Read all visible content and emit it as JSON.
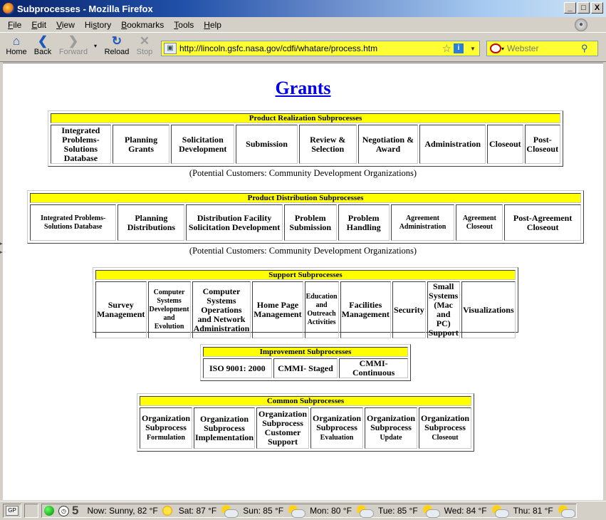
{
  "window": {
    "title": "Subprocesses - Mozilla Firefox",
    "min": "_",
    "max": "□",
    "close": "X"
  },
  "menu": [
    "File",
    "Edit",
    "View",
    "History",
    "Bookmarks",
    "Tools",
    "Help"
  ],
  "menu_underline": [
    "F",
    "E",
    "V",
    "s",
    "B",
    "T",
    "H"
  ],
  "toolbar": {
    "home": "Home",
    "back": "Back",
    "forward": "Forward",
    "reload": "Reload",
    "stop": "Stop",
    "url": "http://lincoln.gsfc.nasa.gov/cdfi/whatare/process.htm",
    "search_placeholder": "Webster"
  },
  "page": {
    "title": "Grants",
    "groups": [
      {
        "header": "Product Realization Subprocesses",
        "cells": [
          "Integrated Problems-Solutions Database",
          "Planning Grants",
          "Solicitation Development",
          "Submission",
          "Review & Selection",
          "Negotiation & Award",
          "Administration",
          "Closeout",
          "Post-Closeout"
        ],
        "caption": "(Potential Customers: Community Development Organizations)"
      },
      {
        "header": "Product Distribution Subprocesses",
        "cells": [
          "Integrated Problems-Solutions Database",
          "Planning Distributions",
          "Distribution Facility Solicitation Development",
          "Problem Submission",
          "Problem Handling",
          "Agreement Administration",
          "Agreement Closeout",
          "Post-Agreement Closeout"
        ],
        "caption": "(Potential Customers: Community Development Organizations)"
      },
      {
        "header": "Support Subprocesses",
        "cells": [
          "Survey Management",
          "Computer Systems Development and Evolution",
          "Computer Systems Operations and Network Administration",
          "Home Page Management",
          "Education and Outreach Activities",
          "Facilities Management",
          "Security",
          "Small Systems (Mac and PC) Support",
          "Visualizations"
        ]
      },
      {
        "header": "Improvement Subprocesses",
        "cells": [
          "ISO 9001: 2000",
          "CMMI- Staged",
          "CMMI- Continuous"
        ]
      },
      {
        "header": "Common Subprocesses",
        "cells": [
          {
            "main": "Organization Subprocess",
            "sub": "Formulation"
          },
          {
            "main": "Organization Subprocess",
            "sub": "Implementation"
          },
          {
            "main": "Organization Subprocess",
            "sub": "Customer Support"
          },
          {
            "main": "Organization Subprocess",
            "sub": "Evaluation"
          },
          {
            "main": "Organization Subprocess",
            "sub": "Update"
          },
          {
            "main": "Organization Subprocess",
            "sub": "Closeout"
          }
        ]
      }
    ]
  },
  "status": {
    "gp": "GP",
    "count": "5",
    "weather": [
      {
        "label": "Now: Sunny, 82 °F",
        "icon": "sun-icon"
      },
      {
        "label": "Sat: 87 °F",
        "icon": "partly-cloudy-icon"
      },
      {
        "label": "Sun: 85 °F",
        "icon": "partly-cloudy-icon"
      },
      {
        "label": "Mon: 80 °F",
        "icon": "partly-cloudy-icon"
      },
      {
        "label": "Tue: 85 °F",
        "icon": "partly-cloudy-icon"
      },
      {
        "label": "Wed: 84 °F",
        "icon": "partly-cloudy-icon"
      },
      {
        "label": "Thu: 81 °F",
        "icon": "partly-cloudy-icon"
      }
    ]
  }
}
